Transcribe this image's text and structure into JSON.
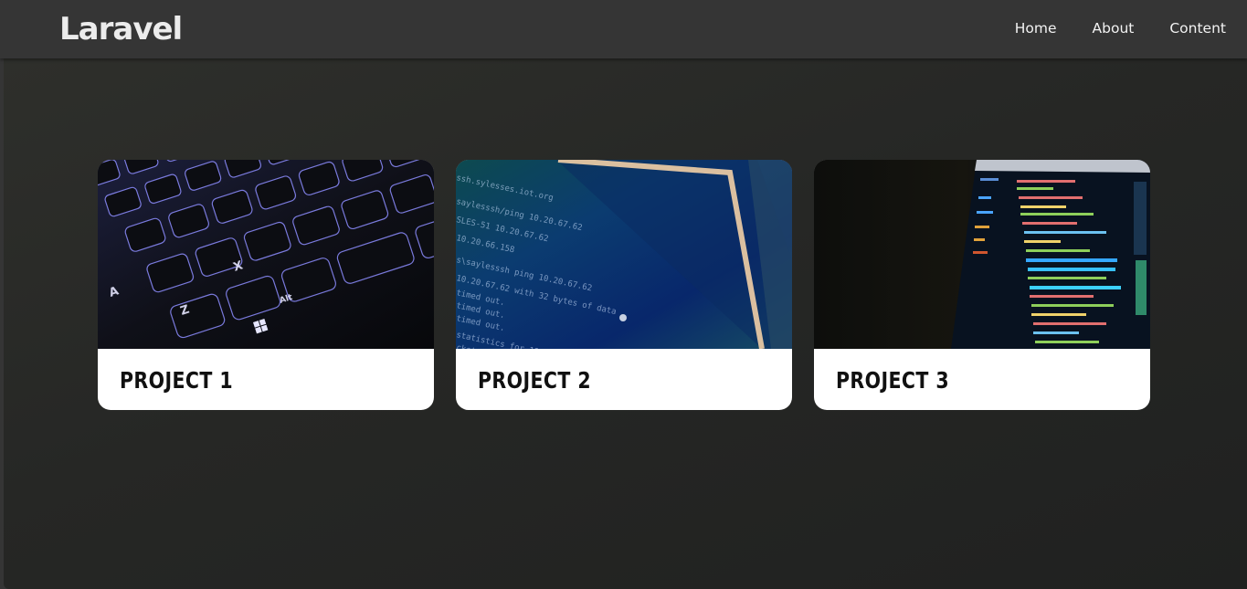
{
  "navbar": {
    "brand": "Laravel",
    "links": [
      "Home",
      "About",
      "Content"
    ]
  },
  "projects": [
    {
      "title": "PROJECT 1",
      "image": "keyboard-backlit-photo"
    },
    {
      "title": "PROJECT 2",
      "image": "terminal-screen-photo"
    },
    {
      "title": "PROJECT 3",
      "image": "code-editor-monitor-photo"
    }
  ],
  "colors": {
    "navbar_bg": "#353535",
    "hero_bg": "#262725",
    "card_bg": "#ffffff",
    "title_text": "#111111",
    "nav_text": "#f2f2f2"
  }
}
